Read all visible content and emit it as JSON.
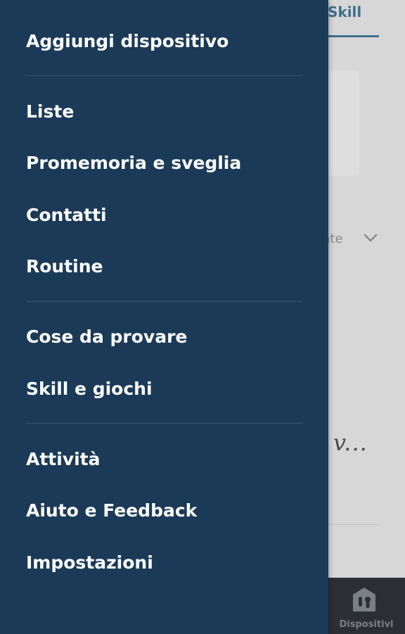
{
  "background": {
    "active_tab_label": "Skill",
    "filter_text": "nte",
    "italic_text": "v...",
    "bottom_nav": {
      "devices_label": "Dispositivi",
      "devices_icon": "devices-icon"
    },
    "colors": {
      "accent": "#3f6f8c",
      "bottom_bar": "#2b2f35"
    }
  },
  "drawer": {
    "background_color": "#1b3a57",
    "sections": [
      {
        "items": [
          {
            "label": "Aggiungi dispositivo"
          }
        ]
      },
      {
        "items": [
          {
            "label": "Liste"
          },
          {
            "label": "Promemoria e sveglia"
          },
          {
            "label": "Contatti"
          },
          {
            "label": "Routine"
          }
        ]
      },
      {
        "items": [
          {
            "label": "Cose da provare"
          },
          {
            "label": "Skill e giochi"
          }
        ]
      },
      {
        "items": [
          {
            "label": "Attività"
          },
          {
            "label": "Aiuto e Feedback"
          },
          {
            "label": "Impostazioni"
          }
        ]
      }
    ]
  }
}
